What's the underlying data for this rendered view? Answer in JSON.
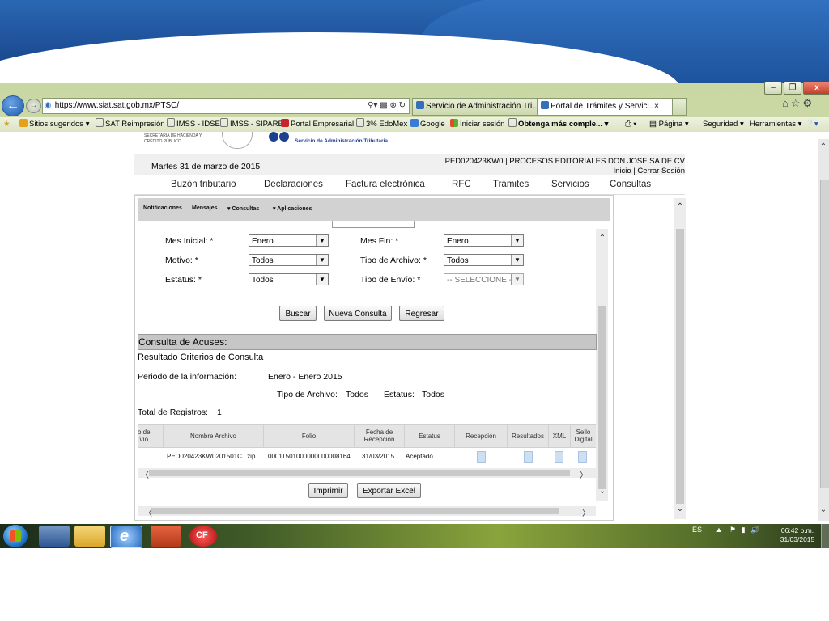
{
  "browser": {
    "url": "https://www.siat.sat.gob.mx/PTSC/",
    "tabs": [
      {
        "label": "Servicio de Administración Tri...",
        "active": false
      },
      {
        "label": "Portal de Trámites y Servici...",
        "active": true
      }
    ],
    "close_glyph": "×",
    "favorites": [
      {
        "label": "Sitios sugeridos ▾",
        "icon": "suggested-sites-icon"
      },
      {
        "label": "SAT Reimpresión",
        "icon": "page-icon"
      },
      {
        "label": "IMSS - IDSE",
        "icon": "page-icon"
      },
      {
        "label": "IMSS - SIPARE",
        "icon": "page-icon"
      },
      {
        "label": "Portal Empresarial",
        "icon": "portal-icon"
      },
      {
        "label": "3% EdoMex",
        "icon": "page-icon"
      },
      {
        "label": "Google",
        "icon": "google-icon"
      },
      {
        "label": "Iniciar sesión",
        "icon": "windows-icon"
      },
      {
        "label": "Obtenga más comple...",
        "icon": "page-icon"
      }
    ],
    "commands": {
      "page": "Página ▾",
      "security": "Seguridad ▾",
      "tools": "Herramientas ▾"
    }
  },
  "header": {
    "agency_small": "SECRETARÍA DE HACIENDA Y CRÉDITO PÚBLICO",
    "agency": "Servicio de Administración Tributaria",
    "date": "Martes 31 de marzo de 2015",
    "rfc_company": "PED020423KW0 | PROCESOS EDITORIALES DON JOSE SA DE CV",
    "links": "Inicio | Cerrar Sesión"
  },
  "main_nav": [
    "Buzón tributario",
    "Declaraciones",
    "Factura electrónica",
    "RFC",
    "Trámites",
    "Servicios",
    "Consultas"
  ],
  "sub_nav": [
    "Notificaciones",
    "Mensajes",
    "▾ Consultas",
    "▾ Aplicaciones"
  ],
  "form": {
    "mes_inicial_label": "Mes Inicial: *",
    "mes_inicial_value": "Enero",
    "mes_fin_label": "Mes Fin: *",
    "mes_fin_value": "Enero",
    "motivo_label": "Motivo: *",
    "motivo_value": "Todos",
    "tipo_archivo_label": "Tipo de Archivo: *",
    "tipo_archivo_value": "Todos",
    "estatus_label": "Estatus: *",
    "estatus_value": "Todos",
    "tipo_envio_label": "Tipo de Envío: *",
    "tipo_envio_value": "-- SELECCIONE --",
    "buttons": {
      "buscar": "Buscar",
      "nueva": "Nueva Consulta",
      "regresar": "Regresar"
    }
  },
  "results": {
    "section_title": "Consulta de Acuses:",
    "subtitle": "Resultado Criterios de Consulta",
    "periodo_label": "Periodo de la información:",
    "periodo_value": "Enero - Enero  2015",
    "tipo_archivo_label": "Tipo de Archivo:",
    "tipo_archivo_value": "Todos",
    "estatus_label": "Estatus:",
    "estatus_value": "Todos",
    "total_label": "Total de Registros:",
    "total_value": "1",
    "columns": [
      "o de\nvío",
      "Nombre Archivo",
      "Folio",
      "Fecha de\nRecepción",
      "Estatus",
      "Recepción",
      "Resultados",
      "XML",
      "Sello\nDigital"
    ],
    "row": {
      "nombre": "PED020423KW0201501CT.zip",
      "folio": "00011501000000000008164",
      "fecha": "31/03/2015",
      "estatus": "Aceptado"
    },
    "buttons": {
      "imprimir": "Imprimir",
      "exportar": "Exportar Excel"
    }
  },
  "taskbar": {
    "lang": "ES",
    "time": "06:42 p.m.",
    "date": "31/03/2015"
  }
}
